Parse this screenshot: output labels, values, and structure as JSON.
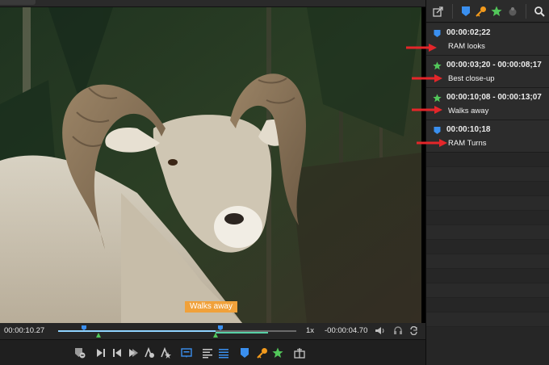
{
  "viewer": {
    "caption": "Walks away",
    "current_timecode": "00:00:10.27",
    "remaining_timecode": "-00:00:04.70",
    "playback_speed": "1x",
    "playhead_fraction": 0.66,
    "in_range": [
      0.66,
      0.88
    ]
  },
  "panel": {
    "tools": [
      "share-icon",
      "marker-icon",
      "key-icon",
      "star-icon",
      "dot-icon",
      "search-icon"
    ],
    "entries": [
      {
        "type": "marker",
        "time": "00:00:02;22",
        "note": "RAM looks"
      },
      {
        "type": "star",
        "time": "00:00:03;20 - 00:00:08;17",
        "note": "Best close-up"
      },
      {
        "type": "star",
        "time": "00:00:10;08 - 00:00:13;07",
        "note": "Walks away"
      },
      {
        "type": "marker",
        "time": "00:00:10;18",
        "note": "RAM Turns"
      }
    ]
  },
  "colors": {
    "marker_blue": "#3a8fef",
    "star_green": "#52c75a",
    "key_orange": "#f39a1c",
    "caption_orange": "#f0a13a",
    "arrow_red": "#e4262a"
  }
}
